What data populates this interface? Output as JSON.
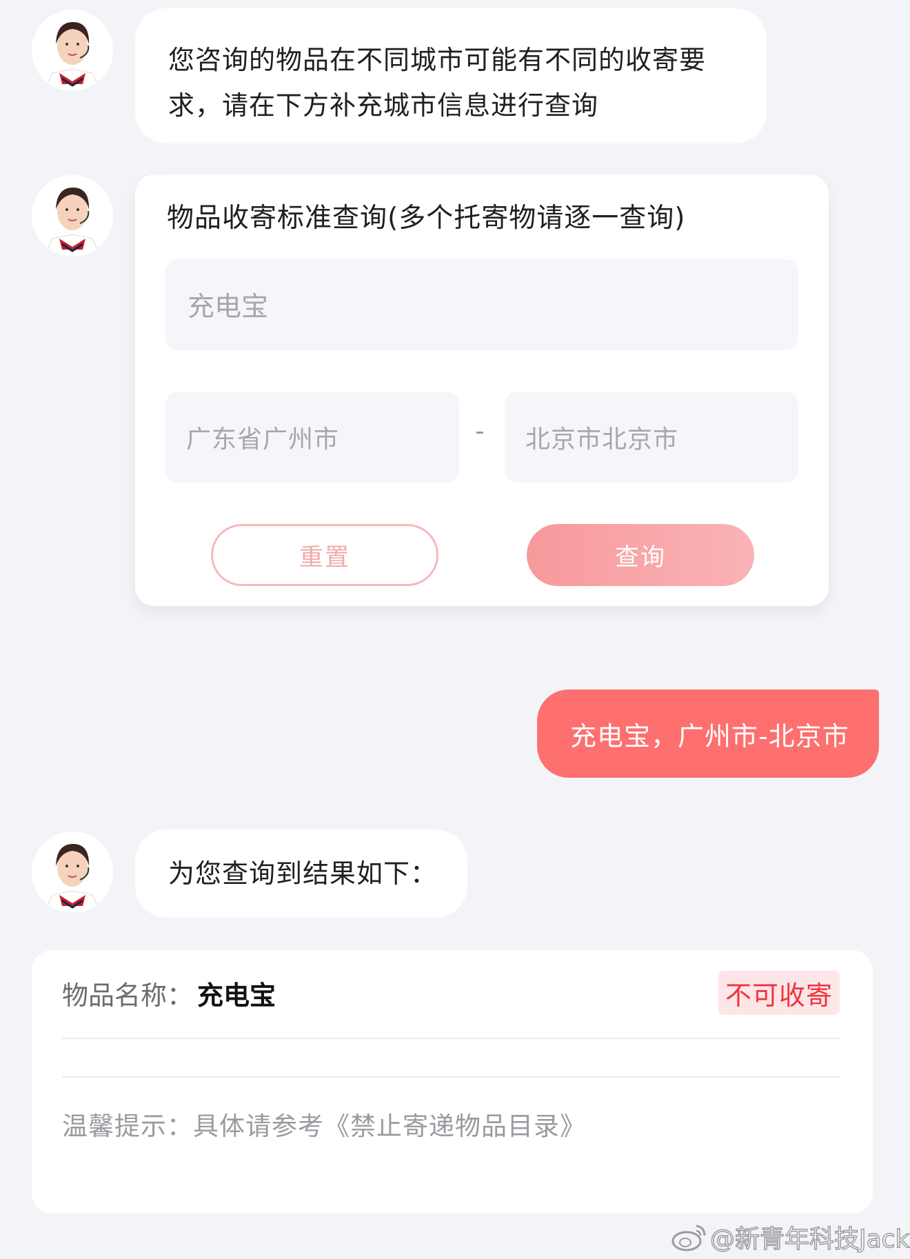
{
  "bot_message_1": "您咨询的物品在不同城市可能有不同的收寄要求，请在下方补充城市信息进行查询",
  "bot_message_1_lines": [
    "您咨询的物品在不同城市可能有不同的收寄要",
    "求，请在下方补充城市信息进行查询"
  ],
  "query_card": {
    "title": "物品收寄标准查询(多个托寄物请逐一查询)",
    "item_value": "充电宝",
    "from_city": "广东省广州市",
    "separator": "-",
    "to_city": "北京市北京市",
    "reset_label": "重置",
    "query_label": "查询"
  },
  "user_message": "充电宝，广州市-北京市",
  "bot_message_2": "为您查询到结果如下：",
  "result": {
    "name_label": "物品名称：",
    "name_value": "充电宝",
    "status": "不可收寄",
    "tip": "温馨提示：具体请参考《禁止寄递物品目录》"
  },
  "watermark": "@新青年科技Jack",
  "colors": {
    "accent": "#fe6f6f",
    "status_red": "#f2333d",
    "status_bg": "#fde6e8",
    "page_bg": "#f3f4f7"
  },
  "icons": [
    "agent-avatar",
    "weibo-logo-icon"
  ]
}
